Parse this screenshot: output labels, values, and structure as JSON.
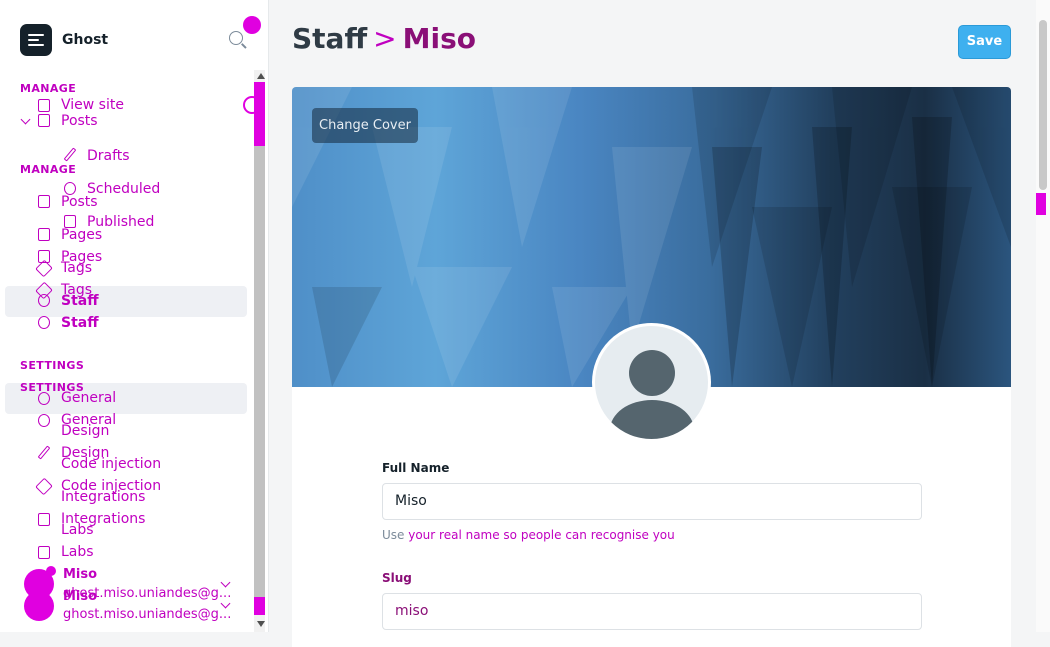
{
  "app": {
    "brand": "Ghost"
  },
  "sidebar": {
    "manage_label": "MANAGE",
    "manage_label_ghost": "MANAGE",
    "view_site": "View site",
    "posts": "Posts",
    "drafts": "Drafts",
    "scheduled": "Scheduled",
    "published": "Published",
    "pages": "Pages",
    "tags": "Tags",
    "staff": "Staff",
    "ghost_posts": "Posts",
    "ghost_pages": "Pages",
    "ghost_tags": "Tags",
    "ghost_staff": "Staff",
    "settings_label": "SETTINGS",
    "settings_label_ghost": "SETTINGS",
    "general": "General",
    "design": "Design",
    "code_injection": "Code injection",
    "integrations": "Integrations",
    "labs": "Labs",
    "ghost_general": "General",
    "ghost_design": "Design",
    "ghost_code_injection": "Code injection",
    "ghost_integrations": "Integrations",
    "ghost_labs": "Labs"
  },
  "user": {
    "name": "Miso",
    "email": "ghost.miso.uniandes@g...",
    "name_ghost": "Miso",
    "email_ghost": "ghost.miso.uniandes@g..."
  },
  "header": {
    "section": "Staff",
    "separator": ">",
    "current": "Miso",
    "save_label": "Save"
  },
  "profile": {
    "change_cover": "Change Cover",
    "full_name_label": "Full Name",
    "full_name_value": "Miso",
    "full_name_help": "Use ",
    "full_name_help_ghost": "your real name so people can recognise you",
    "slug_label": "Slug",
    "slug_value": "miso"
  },
  "colors": {
    "accent": "#3eb0ef",
    "highlight_overlay": "#e000e0"
  }
}
